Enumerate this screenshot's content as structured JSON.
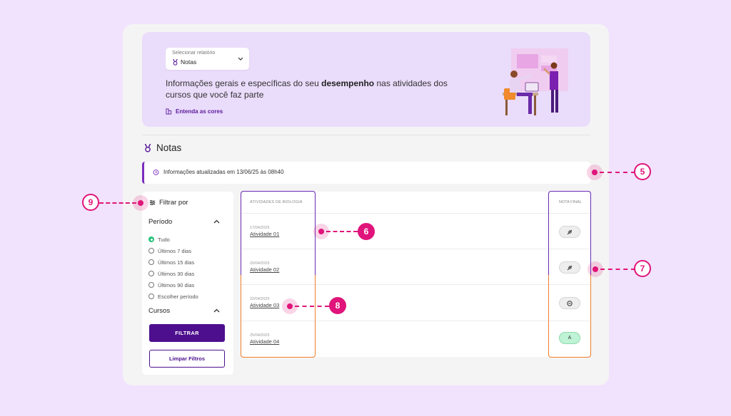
{
  "report_select": {
    "label": "Selecionar relatório",
    "value": "Notas"
  },
  "banner": {
    "text_before": "Informações gerais e específicas do seu ",
    "text_bold": "desempenho",
    "text_after": " nas atividades dos cursos que você faz parte",
    "colors_link": "Entenda as cores"
  },
  "section_title": "Notas",
  "updated_info": "Informações atualizadas em 13/06/25 às 08h40",
  "filter": {
    "title": "Filtrar por",
    "period_title": "Período",
    "period_options": [
      "Tudo",
      "Últimos 7 dias",
      "Últimos 15 dias",
      "Últimos 30 dias",
      "Últimos 90 dias",
      "Escolher período"
    ],
    "selected_option": "Tudo",
    "courses_title": "Cursos",
    "filter_button": "FILTRAR",
    "clear_button": "Limpar Filtros"
  },
  "table": {
    "col_activities": "ATIVIDADES DE BIOLOGIA",
    "col_grade": "NOTA FINAL",
    "rows": [
      {
        "date": "17/04/2025",
        "name": "Atividade 01",
        "grade_icon": "not-submitted-icon",
        "grade": ""
      },
      {
        "date": "20/04/2025",
        "name": "Atividade 02",
        "grade_icon": "not-submitted-icon",
        "grade": ""
      },
      {
        "date": "22/04/2025",
        "name": "Atividade 03",
        "grade_icon": "pending-icon",
        "grade": ""
      },
      {
        "date": "25/04/2025",
        "name": "Atividade 04",
        "grade_icon": "",
        "grade": "A"
      }
    ]
  },
  "annotations": [
    "5",
    "6",
    "7",
    "8",
    "9"
  ],
  "colors": {
    "background": "#f1e2fd",
    "banner": "#eadcfb",
    "primary": "#4d0f8e",
    "annotation": "#e0147a",
    "highlight_top": "#6a2bb5",
    "highlight_bottom": "#f07d2a",
    "grade_a": "#bff3d5"
  }
}
